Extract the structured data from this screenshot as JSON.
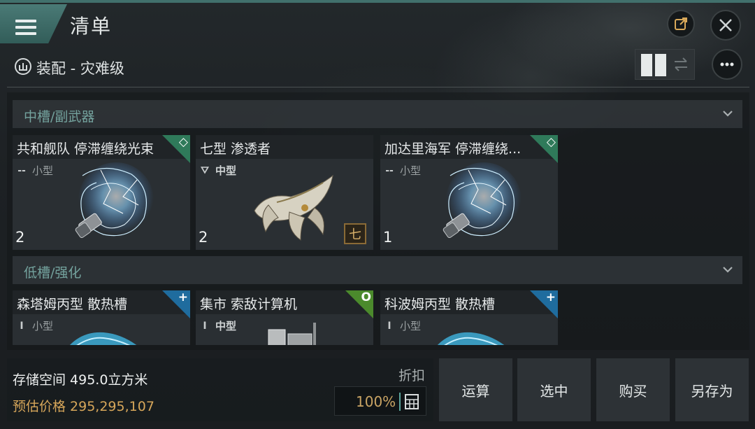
{
  "header": {
    "title": "清单",
    "subtitle": "装配 - 灾难级"
  },
  "sections": [
    {
      "label": "中槽/副武器",
      "items": [
        {
          "name": "共和舰队 停滞缠绕光束",
          "meta_mark": "--",
          "size": "小型",
          "qty": "2",
          "corner": "◇",
          "corner_color": "#2f7a5a"
        },
        {
          "name": "七型 渗透者",
          "meta_mark": "⛛",
          "size": "中型",
          "qty": "2",
          "badge": "七"
        },
        {
          "name": "加达里海军 停滞缠绕...",
          "meta_mark": "--",
          "size": "小型",
          "qty": "1",
          "corner": "◇",
          "corner_color": "#2f7a5a"
        }
      ]
    },
    {
      "label": "低槽/强化",
      "items": [
        {
          "name": "森塔姆丙型 散热槽",
          "meta_mark": "I",
          "size": "小型",
          "corner": "+",
          "corner_color": "#1f6c9e"
        },
        {
          "name": "集市 索敌计算机",
          "meta_mark": "I",
          "size": "中型",
          "corner": "O",
          "corner_color": "#4b8a2c"
        },
        {
          "name": "科波姆丙型 散热槽",
          "meta_mark": "I",
          "size": "小型",
          "corner": "+",
          "corner_color": "#1f6c9e"
        }
      ]
    }
  ],
  "footer": {
    "storage": "存储空间 495.0立方米",
    "price": "预估价格 295,295,107",
    "discount_label": "折扣",
    "discount_value": "100%"
  },
  "actions": [
    "运算",
    "选中",
    "购买",
    "另存为"
  ],
  "colors": {
    "accent": "#41706c",
    "section_text": "#74a39e",
    "price": "#d6a65a"
  }
}
